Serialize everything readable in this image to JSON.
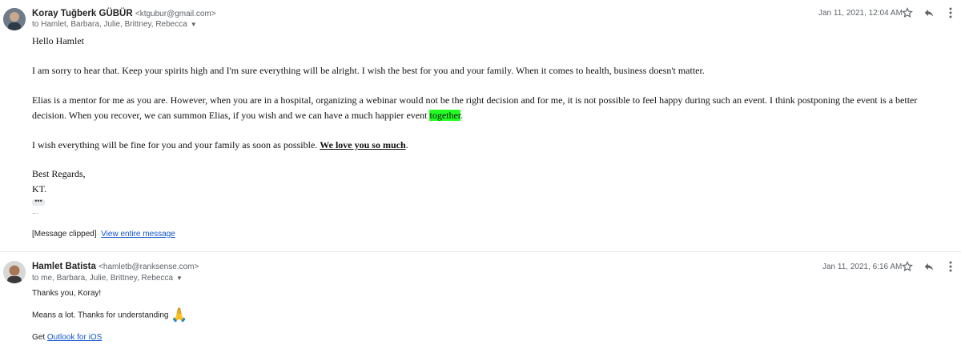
{
  "message1": {
    "sender_name": "Koray Tuğberk GÜBÜR",
    "sender_email": "<ktgubur@gmail.com>",
    "recipients": "to Hamlet, Barbara, Julie, Brittney, Rebecca",
    "date": "Jan 11, 2021, 12:04 AM",
    "greeting": "Hello Hamlet",
    "para1": "I am sorry to hear that. Keep your spirits high and I'm sure everything will be alright. I wish the best for you and your family. When it comes to health, business doesn't matter.",
    "para2_line1": "Elias is a mentor for me as you are. However, when you are in a hospital, organizing a webinar would not be the right decision and for me, it is not possible to feel happy during such an event. I think postponing the event is a better",
    "para2_line2_pre": "decision. When you recover, we can summon Elias, if you wish and we can have a much happier event ",
    "para2_highlight": "together",
    "para2_end": ".",
    "para3_pre": "I wish everything will be fine for you and your family as soon as possible. ",
    "para3_emph": "We love you so much",
    "para3_end": ".",
    "signoff": "Best Regards,",
    "signature": "KT.",
    "ellipsis_button": "•••",
    "trailing": "...",
    "clipped_text": "[Message clipped]",
    "view_entire": "View entire message"
  },
  "message2": {
    "sender_name": "Hamlet Batista",
    "sender_email": "<hamletb@ranksense.com>",
    "recipients": "to me, Barbara, Julie, Brittney, Rebecca",
    "date": "Jan 11, 2021, 6:16 AM",
    "line1": "Thanks you, Koray!",
    "line2": "Means a lot. Thanks for understanding",
    "emoji": "🙏",
    "line3_pre": "Get ",
    "line3_link": "Outlook for iOS"
  },
  "icons": [
    "star-icon",
    "reply-icon",
    "more-vert-icon",
    "chevron-down-icon"
  ]
}
